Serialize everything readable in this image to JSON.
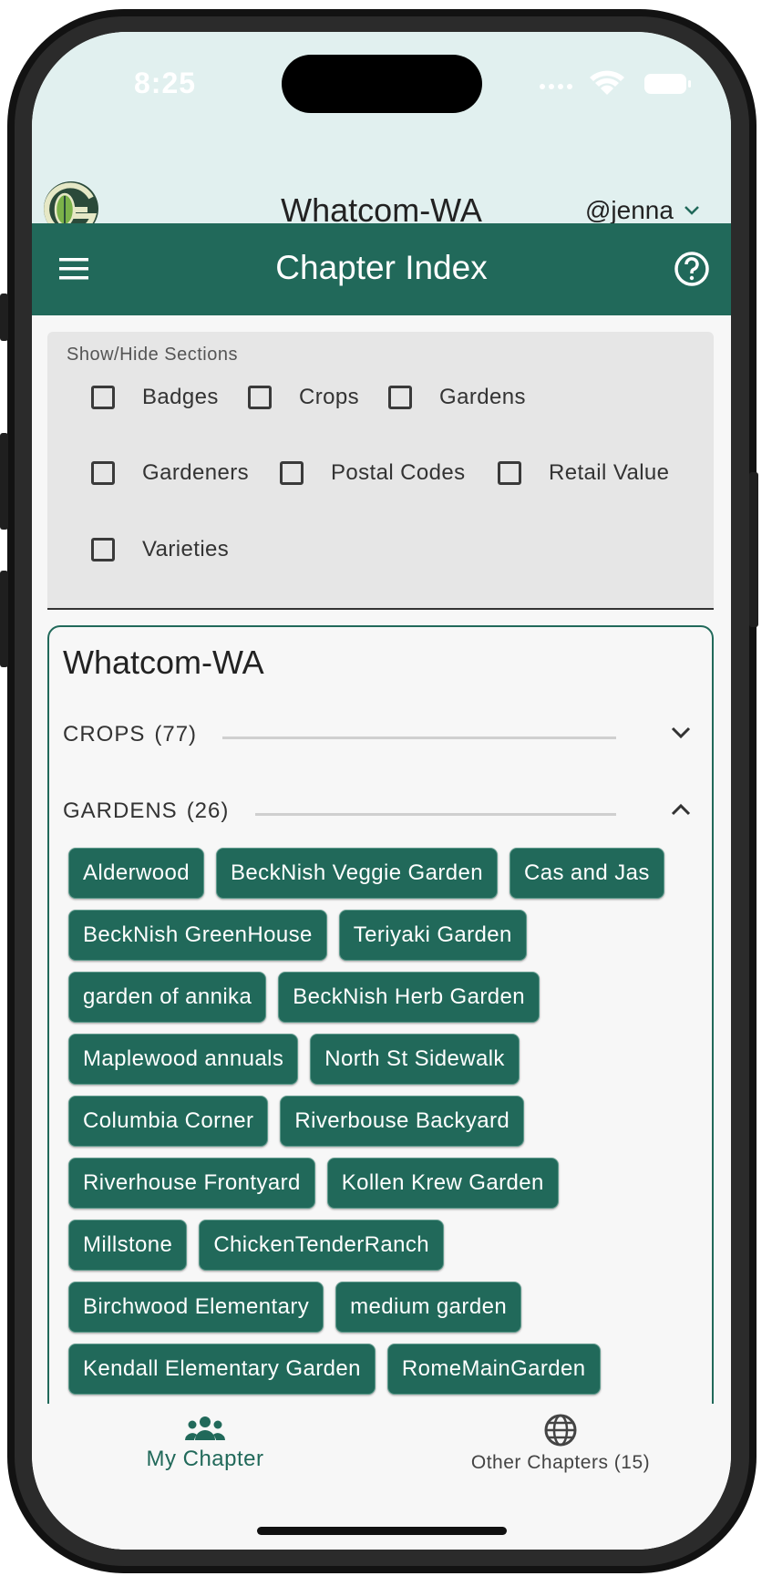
{
  "status_bar": {
    "time": "8:25"
  },
  "app_header": {
    "logo_icon": "garden-g-logo-icon",
    "chapter_name": "Whatcom-WA",
    "user_handle": "@jenna"
  },
  "toolbar": {
    "title": "Chapter Index",
    "menu_icon": "hamburger-menu-icon",
    "help_icon": "help-circle-icon"
  },
  "sections_panel": {
    "label": "Show/Hide Sections",
    "options": [
      {
        "label": "Badges",
        "checked": false
      },
      {
        "label": "Crops",
        "checked": false
      },
      {
        "label": "Gardens",
        "checked": false
      },
      {
        "label": "Gardeners",
        "checked": false
      },
      {
        "label": "Postal Codes",
        "checked": false
      },
      {
        "label": "Retail Value",
        "checked": false
      },
      {
        "label": "Varieties",
        "checked": false
      }
    ]
  },
  "chapter_card": {
    "title": "Whatcom-WA",
    "crops": {
      "label": "CROPS",
      "count": "(77)",
      "expanded": false
    },
    "gardens": {
      "label": "GARDENS",
      "count": "(26)",
      "expanded": true,
      "items": [
        "Alderwood",
        "BeckNish Veggie Garden",
        "Cas and Jas",
        "BeckNish GreenHouse",
        "Teriyaki Garden",
        "garden of annika",
        "BeckNish Herb Garden",
        "Maplewood annuals",
        "North St Sidewalk",
        "Columbia Corner",
        "Riverbouse Backyard",
        "Riverhouse Frontyard",
        "Kollen Krew Garden",
        "Millstone",
        "ChickenTenderRanch",
        "Birchwood Elementary",
        "medium garden",
        "Kendall Elementary Garden",
        "RomeMainGarden"
      ]
    }
  },
  "bottom_nav": {
    "my_chapter": {
      "label": "My Chapter",
      "icon": "people-group-icon",
      "active": true
    },
    "other_chapters": {
      "label": "Other Chapters (15)",
      "icon": "globe-icon",
      "active": false
    }
  },
  "colors": {
    "primary": "#21695a",
    "header_bg": "#e1f0ef",
    "panel_bg": "#e6e6e6"
  }
}
